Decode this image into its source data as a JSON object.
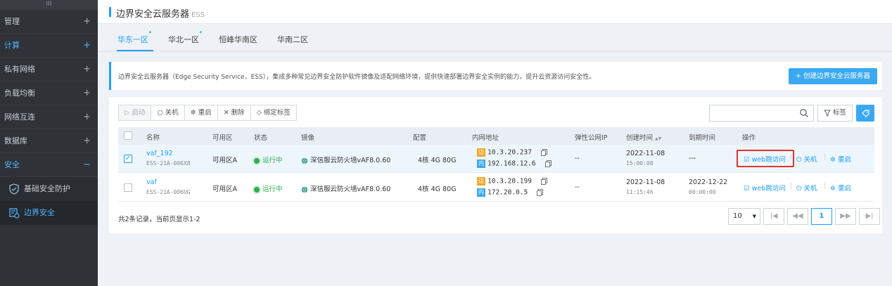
{
  "sidebar": {
    "handle": "III",
    "items": [
      {
        "label": "管理",
        "plus": "+"
      },
      {
        "label": "计算",
        "plus": "+"
      },
      {
        "label": "私有网络",
        "plus": "+"
      },
      {
        "label": "负载均衡",
        "plus": "+"
      },
      {
        "label": "网络互连",
        "plus": "+"
      },
      {
        "label": "数据库",
        "plus": "+"
      },
      {
        "label": "安全",
        "plus": "−"
      }
    ],
    "sub": [
      {
        "label": "基础安全防护",
        "icon": "shield-check-icon"
      },
      {
        "label": "边界安全",
        "icon": "boundary-security-icon"
      }
    ]
  },
  "header": {
    "title": "边界安全云服务器",
    "suffix": "ESS"
  },
  "tabs": [
    "华东一区",
    "华北一区",
    "恒峰华南区",
    "华南二区"
  ],
  "tab_dot": "•",
  "description": "边界安全云服务器（Edge Security Service，ESS），集成多种常见边界安全防护软件镜像及适配网络环境，提供快速部署边界安全实例的能力，提升云资源访问安全性。",
  "create_button": "+ 创建边界安全云服务器",
  "toolbar": {
    "start": "▷ 启动",
    "shutdown": "○ 关机",
    "restart": "✲ 重启",
    "delete": "✕ 删除",
    "bind_tag": "◇ 绑定标签"
  },
  "tag_button": "标签",
  "columns": {
    "name": "名称",
    "zone": "可用区",
    "status": "状态",
    "image": "镜像",
    "config": "配置",
    "intranet": "内网地址",
    "eip": "弹性公网IP",
    "created": "创建时间",
    "expire": "到期时间",
    "ops": "操作"
  },
  "sort_icon": "▲▼",
  "rows": [
    {
      "name": "vaf_192",
      "id": "ESS-21A-006X8",
      "zone": "可用区A",
      "status": "运行中",
      "image": "深信服云防火墙vAF8.0.60",
      "config": "4核 4G 80G",
      "ip1_tag": "边",
      "ip1": "10.3.20.237",
      "ip2_tag": "内",
      "ip2": "192.168.12.6",
      "eip": "--",
      "created_date": "2022-11-08",
      "created_time": "15:00:08",
      "expire_date": "---",
      "expire_time": "",
      "op1": "web跳访问",
      "op2": "关机",
      "op3": "重启",
      "checked": "✓"
    },
    {
      "name": "vaf",
      "id": "ESS-21A-006UG",
      "zone": "可用区A",
      "status": "运行中",
      "image": "深信服云防火墙vAF8.0.60",
      "config": "4核 4G 80G",
      "ip1_tag": "边",
      "ip1": "10.3.20.199",
      "ip2_tag": "内",
      "ip2": "172.20.0.5",
      "eip": "--",
      "created_date": "2022-11-08",
      "created_time": "11:15:46",
      "expire_date": "2022-12-22",
      "expire_time": "00:00:00",
      "op1": "web跳访问",
      "op2": "关机",
      "op3": "重启",
      "checked": ""
    }
  ],
  "op_icons": {
    "web": "☑",
    "power": "⏻",
    "restart": "✲"
  },
  "footer": "共2条记录，当前页显示1-2",
  "pager": {
    "page_size": "10",
    "page_size_arrow": "▼",
    "first": "|◀",
    "prev": "◀◀",
    "current": "1",
    "next": "▶▶",
    "last": "▶|"
  },
  "colors": {
    "accent": "#1e9fff",
    "sidebar_bg": "#2f3337",
    "status_green": "#2fae4f",
    "ip_edge": "#f5a623",
    "ip_internal": "#3aa9f2",
    "highlight": "#e2352a"
  }
}
